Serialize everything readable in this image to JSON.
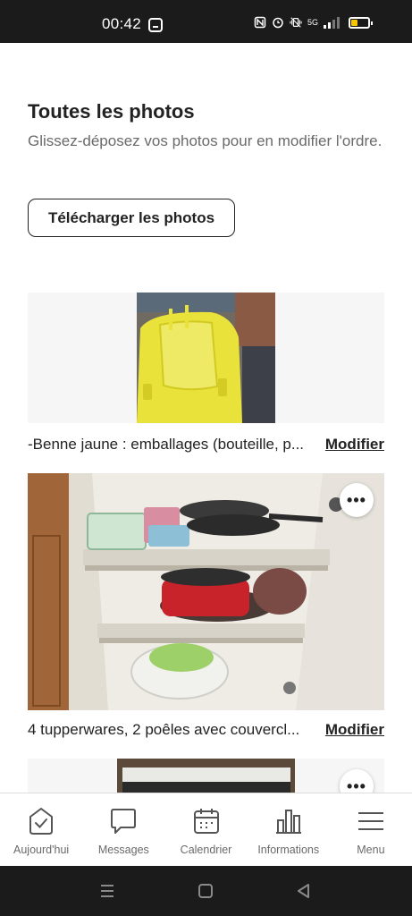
{
  "status_bar": {
    "time": "00:42",
    "network": "5G",
    "icons": [
      "app-icon",
      "nfc-icon",
      "alarm-icon",
      "vibrate-icon",
      "network-5g-icon",
      "signal-icon",
      "battery-icon"
    ],
    "battery_color": "#f7c600"
  },
  "header": {
    "title": "Toutes les photos",
    "subtitle": "Glissez-déposez vos photos pour en modifier l'ordre."
  },
  "upload_button": {
    "label": "Télécharger les photos"
  },
  "photos": [
    {
      "caption": "-Benne jaune : emballages (bouteille, p...",
      "action_label": "Modifier",
      "subject": "yellow recycling bin lid"
    },
    {
      "caption": "4 tupperwares, 2 poêles avec couvercl...",
      "action_label": "Modifier",
      "subject": "kitchen cupboard with pans and containers"
    },
    {
      "caption": "",
      "action_label": "",
      "subject": "oven / appliance"
    }
  ],
  "bottom_nav": {
    "items": [
      {
        "label": "Aujourd'hui",
        "icon": "today-check-icon"
      },
      {
        "label": "Messages",
        "icon": "message-bubble-icon"
      },
      {
        "label": "Calendrier",
        "icon": "calendar-icon"
      },
      {
        "label": "Informations",
        "icon": "bar-chart-icon"
      },
      {
        "label": "Menu",
        "icon": "hamburger-menu-icon"
      }
    ]
  },
  "system_nav": {
    "icons": [
      "recent-apps-icon",
      "home-icon",
      "back-icon"
    ]
  },
  "colors": {
    "text": "#222222",
    "muted": "#6a6a6a",
    "photo_bg": "#f6f6f6",
    "bar_dark": "#1b1b1b"
  }
}
